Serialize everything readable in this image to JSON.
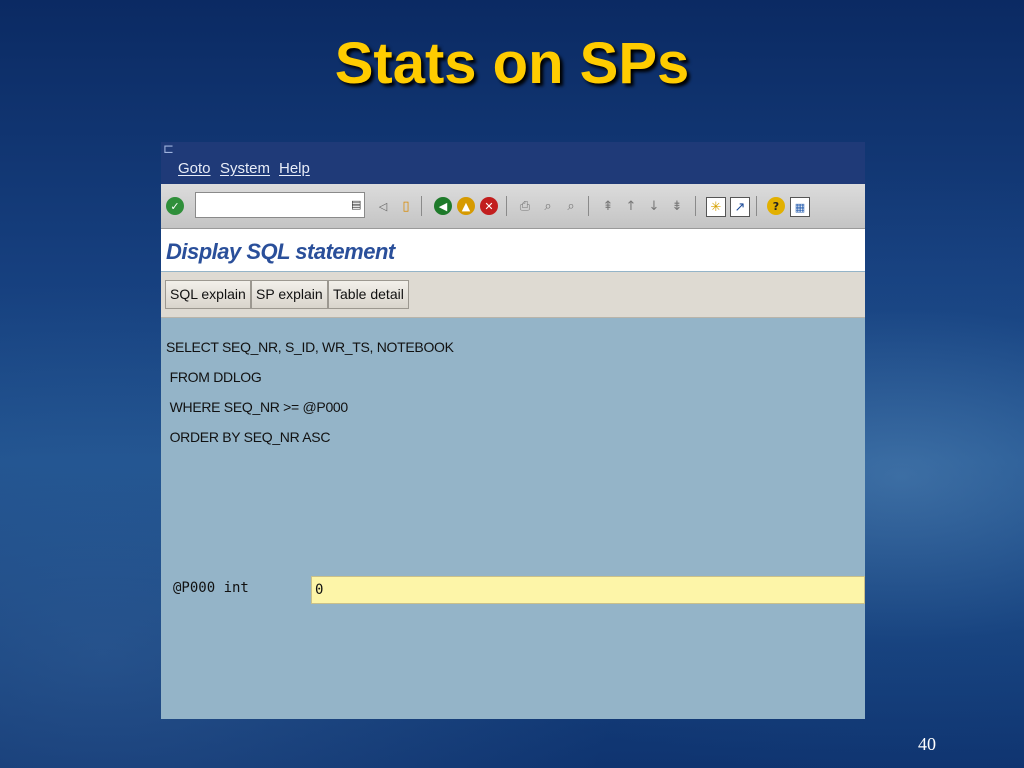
{
  "slide": {
    "title": "Stats on SPs",
    "page_number": "40"
  },
  "menu": {
    "corner_glyph": "⊏",
    "items": [
      "Goto",
      "System",
      "Help"
    ]
  },
  "toolbar": {
    "icons": [
      "enter-icon",
      "command-field",
      "back-arrow-icon",
      "save-icon",
      "back-icon",
      "exit-icon",
      "cancel-icon",
      "print-icon",
      "find-icon",
      "find-next-icon",
      "first-page-icon",
      "previous-page-icon",
      "next-page-icon",
      "last-page-icon",
      "create-session-icon",
      "shortcut-icon",
      "help-icon",
      "layout-menu-icon"
    ]
  },
  "screen": {
    "title": "Display SQL statement"
  },
  "app_toolbar": {
    "buttons": [
      "SQL explain",
      "SP explain",
      "Table detail"
    ]
  },
  "sql": {
    "lines": [
      "SELECT SEQ_NR, S_ID, WR_TS, NOTEBOOK",
      " FROM DDLOG",
      " WHERE SEQ_NR >= @P000",
      " ORDER BY SEQ_NR ASC"
    ]
  },
  "parameter": {
    "label": "@P000 int",
    "value": "0"
  },
  "colors": {
    "title": "#ffcc00",
    "menubar": "#1f3a78",
    "content_bg": "#94b4c8",
    "input_bg": "#fdf5a8"
  }
}
